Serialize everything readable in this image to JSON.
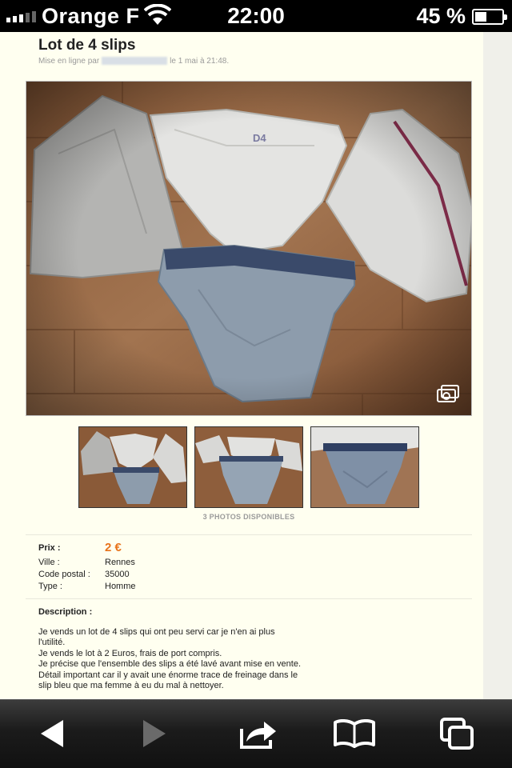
{
  "status_bar": {
    "carrier": "Orange F",
    "time": "22:00",
    "battery_percent": "45 %",
    "battery_level": 0.45,
    "signal_bars": 5,
    "signal_active": 3
  },
  "ad": {
    "title": "Lot de 4 slips",
    "meta_prefix": "Mise en ligne par",
    "meta_suffix": "le 1 mai à 21:48.",
    "photo_count": "3 PHOTOS DISPONIBLES"
  },
  "details": {
    "price_label": "Prix :",
    "price_value": "2 €",
    "city_label": "Ville :",
    "city_value": "Rennes",
    "postal_label": "Code postal :",
    "postal_value": "35000",
    "type_label": "Type :",
    "type_value": "Homme"
  },
  "description": {
    "label": "Description :",
    "lines": [
      "Je vends un lot de 4 slips qui ont peu servi car je n'en ai plus",
      "l'utilité.",
      "Je vends le lot à 2 Euros, frais de port compris.",
      "Je précise que l'ensemble des slips a été lavé avant mise en vente.",
      "Détail important car il y avait une énorme trace de freinage dans le",
      "slip bleu que ma femme à eu du mal à nettoyer."
    ]
  },
  "toolbar": {
    "icons": [
      "back-arrow-icon",
      "forward-arrow-icon",
      "share-icon",
      "bookmarks-icon",
      "tabs-icon"
    ]
  }
}
